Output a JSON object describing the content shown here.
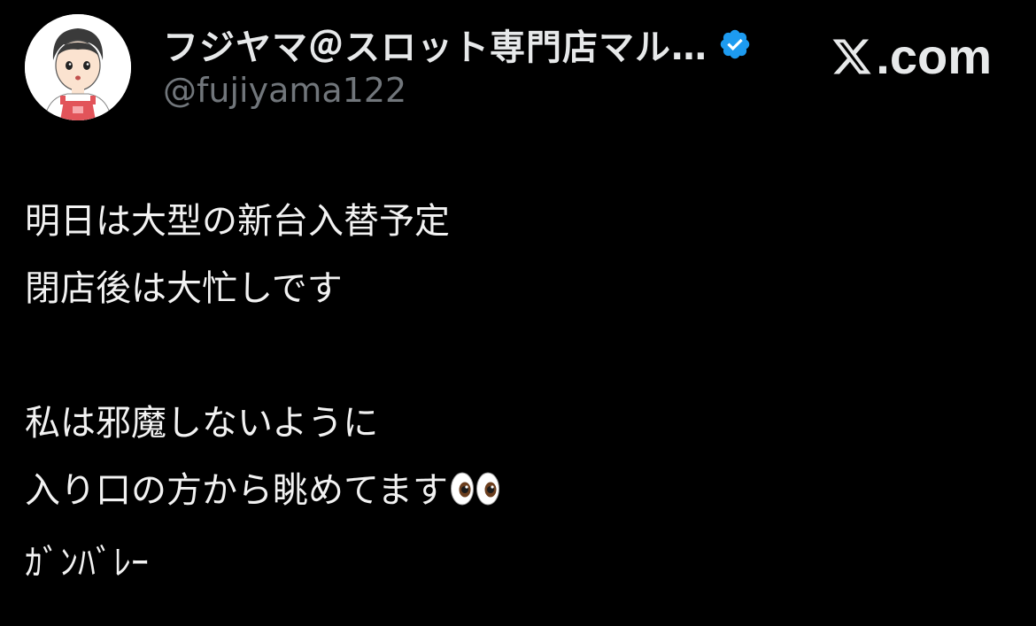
{
  "account": {
    "display_name": "フジヤマ＠スロット専門店マル…",
    "handle": "@fujiyama122",
    "verified": true,
    "avatar_icon": "cartoon-person-avatar-icon",
    "verified_icon": "verified-badge-icon"
  },
  "brand": {
    "logo_icon": "x-logo-icon",
    "text": ".com"
  },
  "tweet": {
    "lines": [
      "明日は大型の新台入替予定",
      "閉店後は大忙しです",
      "",
      "私は邪魔しないように",
      "入り口の方から眺めてます",
      "ｶﾞﾝﾊﾞﾚｰ"
    ],
    "emoji_icon": "eyes-emoji-icon"
  },
  "colors": {
    "background": "#000000",
    "text_primary": "#e7e9ea",
    "text_secondary": "#71767b",
    "verified_blue": "#1d9bf0"
  }
}
